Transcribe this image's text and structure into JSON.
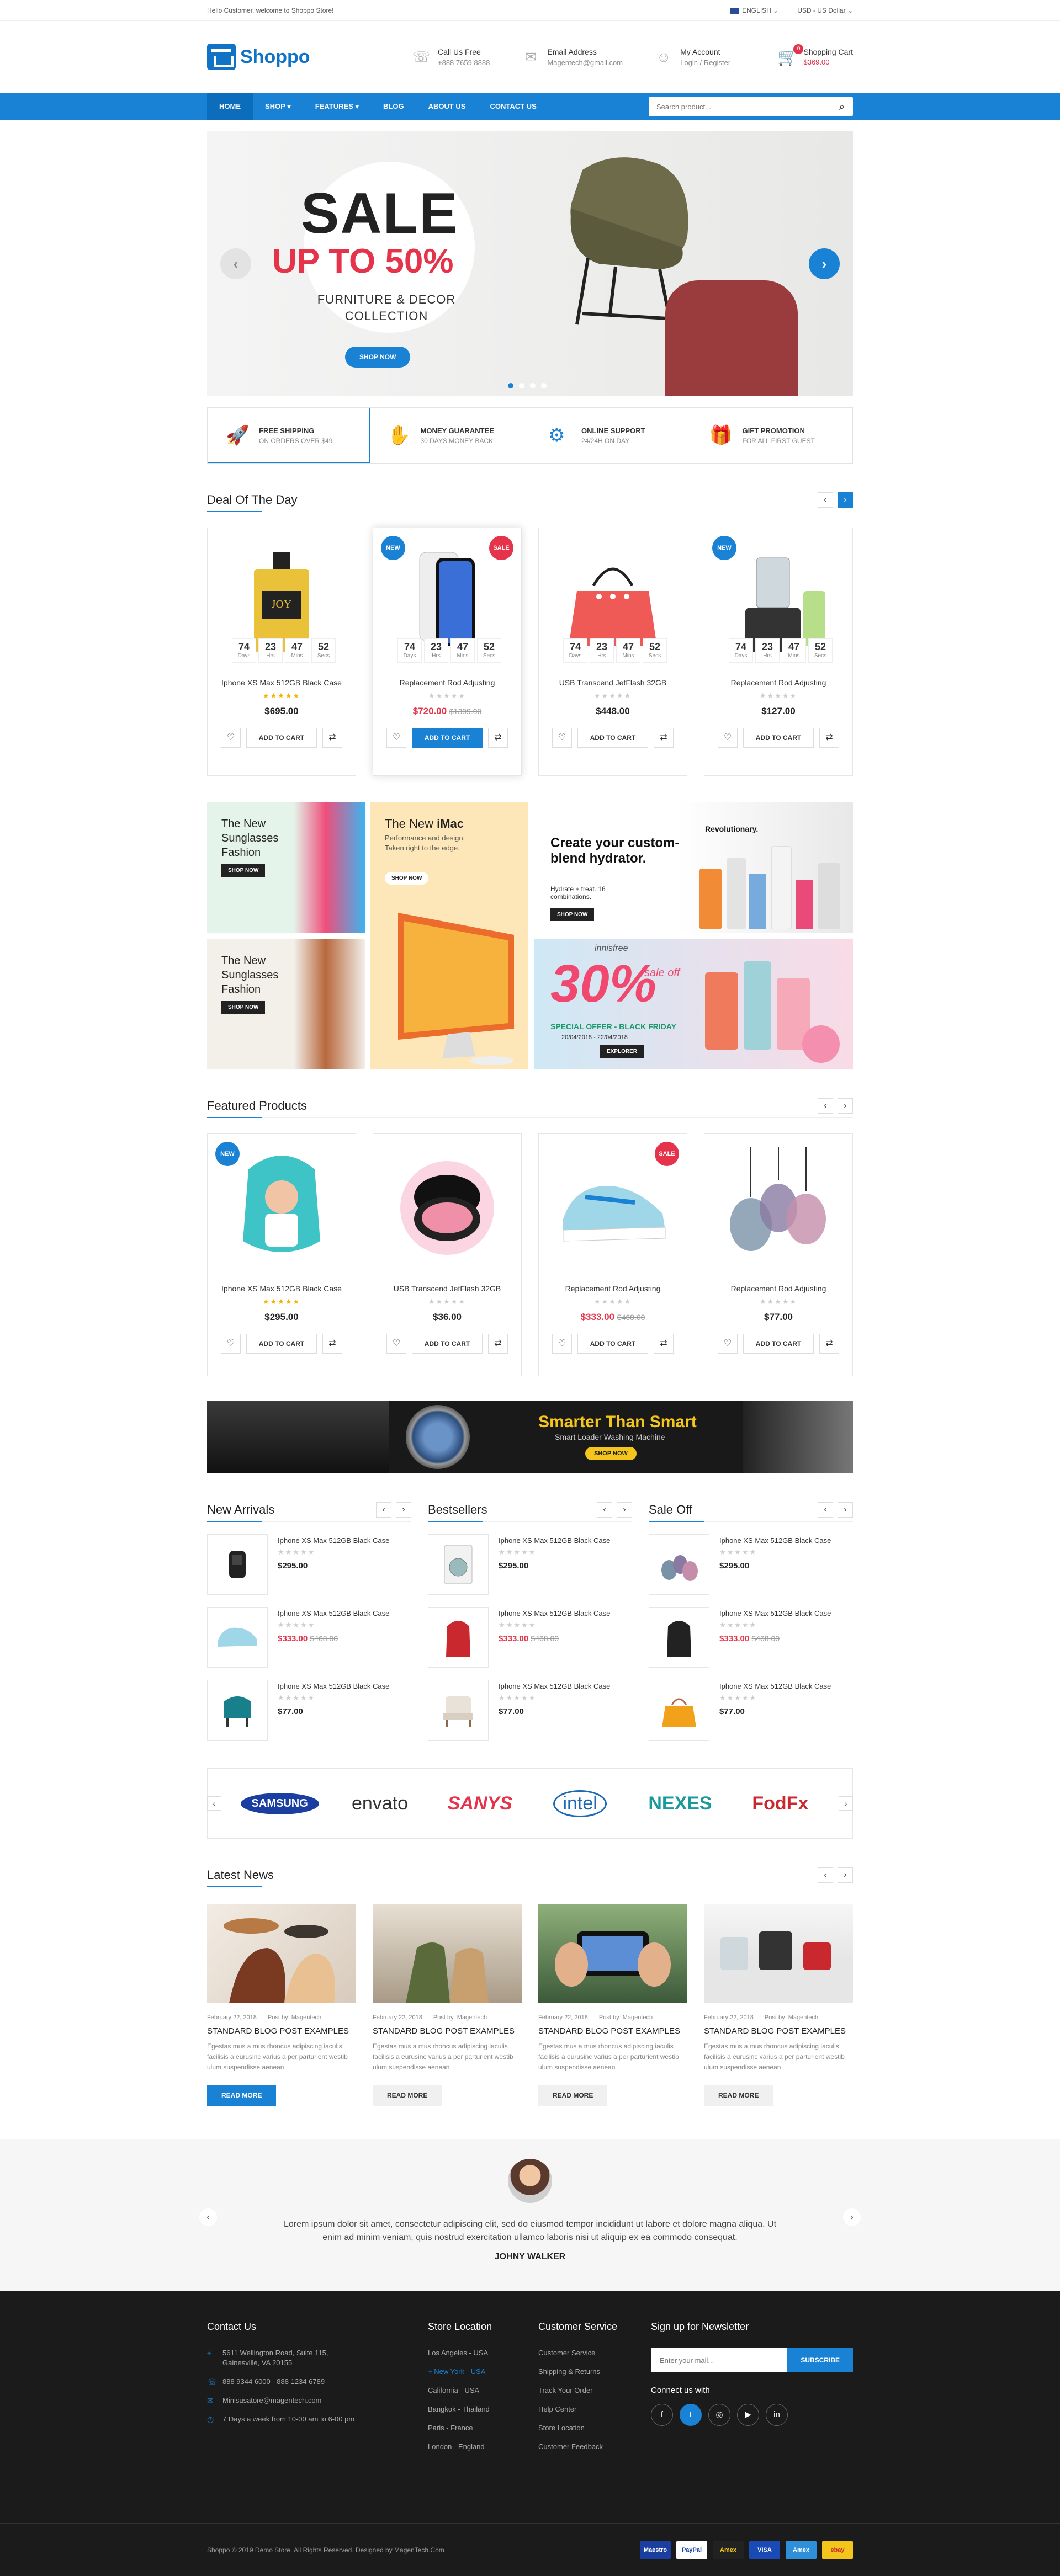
{
  "topbar": {
    "welcome": "Hello Customer, welcome to Shoppo Store!",
    "language": "ENGLISH",
    "currency": "USD - US Dollar"
  },
  "header": {
    "logo": "Shoppo",
    "call_title": "Call Us Free",
    "call_value": "+888 7659 8888",
    "email_title": "Email Address",
    "email_value": "Magentech@gmail.com",
    "account_title": "My Account",
    "account_value": "Login / Register",
    "cart_title": "Shopping Cart",
    "cart_value": "$369.00",
    "cart_count": "0"
  },
  "nav": {
    "items": [
      "HOME",
      "SHOP",
      "FEATURES",
      "BLOG",
      "ABOUT US",
      "CONTACT US"
    ],
    "search_placeholder": "Search product..."
  },
  "hero": {
    "title": "SALE",
    "subtitle": "UP TO 50%",
    "line1": "FURNITURE & DECOR",
    "line2": "COLLECTION",
    "button": "SHOP NOW",
    "slide_count": 4,
    "active_slide": 1
  },
  "features": [
    {
      "title": "FREE SHIPPING",
      "sub": "ON ORDERS OVER $49",
      "icon": "rocket-icon"
    },
    {
      "title": "MONEY GUARANTEE",
      "sub": "30 DAYS MONEY BACK",
      "icon": "hand-money-icon"
    },
    {
      "title": "ONLINE SUPPORT",
      "sub": "24/24H ON DAY",
      "icon": "support-icon"
    },
    {
      "title": "GIFT PROMOTION",
      "sub": "FOR ALL FIRST GUEST",
      "icon": "gift-icon"
    }
  ],
  "deal": {
    "title": "Deal Of The Day",
    "timer": [
      {
        "value": "74",
        "label": "Days"
      },
      {
        "value": "23",
        "label": "Hrs"
      },
      {
        "value": "47",
        "label": "Mins"
      },
      {
        "value": "52",
        "label": "Secs"
      }
    ],
    "add_to_cart": "ADD TO CART",
    "products": [
      {
        "name": "Iphone XS Max 512GB Black Case",
        "price": "$695.00",
        "old_price": "",
        "rated": true,
        "badge_new": false,
        "badge_sale": false
      },
      {
        "name": "Replacement Rod Adjusting",
        "price": "$720.00",
        "old_price": "$1399.00",
        "rated": false,
        "badge_new": true,
        "badge_sale": true
      },
      {
        "name": "USB Transcend JetFlash 32GB",
        "price": "$448.00",
        "old_price": "",
        "rated": false,
        "badge_new": false,
        "badge_sale": false
      },
      {
        "name": "Replacement Rod Adjusting",
        "price": "$127.00",
        "old_price": "",
        "rated": false,
        "badge_new": true,
        "badge_sale": false
      }
    ]
  },
  "promo": {
    "b1": "The New Sunglasses Fashion",
    "b1_btn": "SHOP NOW",
    "b2_title": "The New ",
    "b2_bold": "iMac",
    "b2_sub": "Performance and design. Taken right to the edge.",
    "b2_btn": "SHOP NOW",
    "b3_title": "Create your custom-blend hydrator.",
    "b3_sub": "Hydrate + treat. 16 combinations.",
    "b3_tag": "Revolutionary.",
    "b3_btn": "SHOP NOW",
    "b4": "The New Sunglasses Fashion",
    "b4_btn": "SHOP NOW",
    "b5_brand": "innisfree",
    "b5_big": "30%",
    "b5_off": "sale off",
    "b5_offer": "SPECIAL OFFER - BLACK FRIDAY",
    "b5_dates": "20/04/2018 - 22/04/2018",
    "b5_btn": "EXPLORER"
  },
  "featured": {
    "title": "Featured Products",
    "add_to_cart": "ADD TO CART",
    "products": [
      {
        "name": "Iphone XS Max 512GB Black Case",
        "price": "$295.00",
        "old_price": "",
        "rated": true,
        "badge_new": true,
        "badge_sale": false
      },
      {
        "name": "USB Transcend JetFlash 32GB",
        "price": "$36.00",
        "old_price": "",
        "rated": false,
        "badge_new": false,
        "badge_sale": false
      },
      {
        "name": "Replacement Rod Adjusting",
        "price": "$333.00",
        "old_price": "$468.00",
        "rated": false,
        "badge_new": false,
        "badge_sale": true
      },
      {
        "name": "Replacement Rod Adjusting",
        "price": "$77.00",
        "old_price": "",
        "rated": false,
        "badge_new": false,
        "badge_sale": false
      }
    ]
  },
  "appliance": {
    "headline": "Smarter Than Smart",
    "sub": "Smart Loader Washing Machine",
    "button": "SHOP NOW"
  },
  "lists": [
    {
      "title": "New Arrivals",
      "items": [
        {
          "name": "Iphone XS Max 512GB Black Case",
          "price": "$295.00",
          "old_price": ""
        },
        {
          "name": "Iphone XS Max 512GB Black Case",
          "price": "$333.00",
          "old_price": "$468.00"
        },
        {
          "name": "Iphone XS Max 512GB Black Case",
          "price": "$77.00",
          "old_price": ""
        }
      ]
    },
    {
      "title": "Bestsellers",
      "items": [
        {
          "name": "Iphone XS Max 512GB Black Case",
          "price": "$295.00",
          "old_price": ""
        },
        {
          "name": "Iphone XS Max 512GB Black Case",
          "price": "$333.00",
          "old_price": "$468.00"
        },
        {
          "name": "Iphone XS Max 512GB Black Case",
          "price": "$77.00",
          "old_price": ""
        }
      ]
    },
    {
      "title": "Sale Off",
      "items": [
        {
          "name": "Iphone XS Max 512GB Black Case",
          "price": "$295.00",
          "old_price": ""
        },
        {
          "name": "Iphone XS Max 512GB Black Case",
          "price": "$333.00",
          "old_price": "$468.00"
        },
        {
          "name": "Iphone XS Max 512GB Black Case",
          "price": "$77.00",
          "old_price": ""
        }
      ]
    }
  ],
  "brands": [
    "SAMSUNG",
    "envato",
    "SANYS",
    "intel",
    "NEXES",
    "FodFx"
  ],
  "news": {
    "title": "Latest News",
    "posts": [
      {
        "date": "February 22, 2018",
        "author": "Post by: Magentech",
        "title": "STANDARD BLOG POST EXAMPLES",
        "desc": "Egestas mus a mus rhoncus adipiscing iaculis facilisis a eurusinc varius a per parturient westib ulum suspendisse aenean",
        "button": "READ MORE"
      },
      {
        "date": "February 22, 2018",
        "author": "Post by: Magentech",
        "title": "STANDARD BLOG POST EXAMPLES",
        "desc": "Egestas mus a mus rhoncus adipiscing iaculis facilisis a eurusinc varius a per parturient westib ulum suspendisse aenean",
        "button": "READ MORE"
      },
      {
        "date": "February 22, 2018",
        "author": "Post by: Magentech",
        "title": "STANDARD BLOG POST EXAMPLES",
        "desc": "Egestas mus a mus rhoncus adipiscing iaculis facilisis a eurusinc varius a per parturient westib ulum suspendisse aenean",
        "button": "READ MORE"
      },
      {
        "date": "February 22, 2018",
        "author": "Post by: Magentech",
        "title": "STANDARD BLOG POST EXAMPLES",
        "desc": "Egestas mus a mus rhoncus adipiscing iaculis facilisis a eurusinc varius a per parturient westib ulum suspendisse aenean",
        "button": "READ MORE"
      }
    ]
  },
  "testimonial": {
    "quote": "Lorem ipsum dolor sit amet, consectetur adipiscing elit, sed do eiusmod tempor incididunt ut labore et dolore magna aliqua. Ut enim ad minim veniam, quis nostrud exercitation ullamco laboris nisi ut aliquip ex ea commodo consequat.",
    "name": "JOHNY WALKER"
  },
  "footer": {
    "contact_title": "Contact Us",
    "address": "5611 Wellington Road, Suite 115, Gainesville, VA 20155",
    "phone": "888 9344 6000 - 888 1234 6789",
    "email": "Minisusatore@magentech.com",
    "hours": "7 Days a week from 10-00 am to 6-00 pm",
    "store_title": "Store Location",
    "stores": [
      "Los Angeles - USA",
      "New York - USA",
      "California - USA",
      "Bangkok - Thailand",
      "Paris - France",
      "London - England"
    ],
    "service_title": "Customer Service",
    "services": [
      "Customer Service",
      "Shipping & Returns",
      "Track Your Order",
      "Help Center",
      "Store Location",
      "Customer Feedback"
    ],
    "newsletter_title": "Sign up for Newsletter",
    "newsletter_placeholder": "Enter your mail...",
    "subscribe": "SUBSCRIBE",
    "connect": "Connect us with",
    "copyright": "Shoppo © 2019 Demo Store. All Rights Reserved. Designed by MagenTech.Com",
    "payments": [
      "Maestro",
      "PayPal",
      "Amex",
      "VISA",
      "Amex",
      "ebay"
    ]
  },
  "colors": {
    "accent": "#1a82d5",
    "sale": "#e4334a",
    "star": "#f5b301"
  }
}
